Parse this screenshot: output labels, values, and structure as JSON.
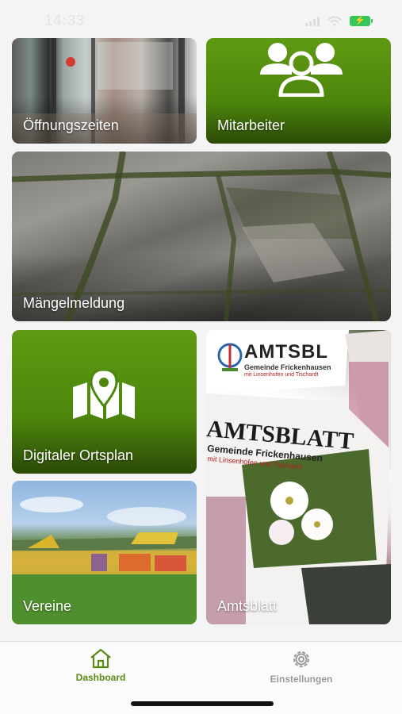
{
  "status_bar": {
    "time": "14:33"
  },
  "tiles": {
    "oeffnungszeiten": {
      "label": "Öffnungszeiten",
      "icon": "storefront-photo"
    },
    "mitarbeiter": {
      "label": "Mitarbeiter",
      "icon": "people-group-icon"
    },
    "maengelmeldung": {
      "label": "Mängelmeldung",
      "icon": "cracked-pavement-photo"
    },
    "ortsplan": {
      "label": "Digitaler Ortsplan",
      "icon": "map-pin-icon"
    },
    "vereine": {
      "label": "Vereine",
      "icon": "sports-field-photo"
    },
    "amtsblatt": {
      "label": "Amtsblatt",
      "cover_title_top": "AMTSBL",
      "cover_subtitle_top": "Gemeinde Frickenhausen",
      "cover_subtitle_top_2": "mit Linsenhofen und Tischardt",
      "cover_title_main": "AMTSBLATT",
      "cover_subtitle_main": "Gemeinde Frickenhausen",
      "cover_subtitle_main_2": "mit Linsenhofen und Tischardt"
    }
  },
  "tabbar": {
    "dashboard": {
      "label": "Dashboard",
      "icon": "home-icon",
      "active": true
    },
    "settings": {
      "label": "Einstellungen",
      "icon": "gear-icon",
      "active": false
    }
  },
  "colors": {
    "brand_green": "#4d860c",
    "active_tab": "#5d8a16",
    "inactive_tab": "#9a9a9a"
  }
}
